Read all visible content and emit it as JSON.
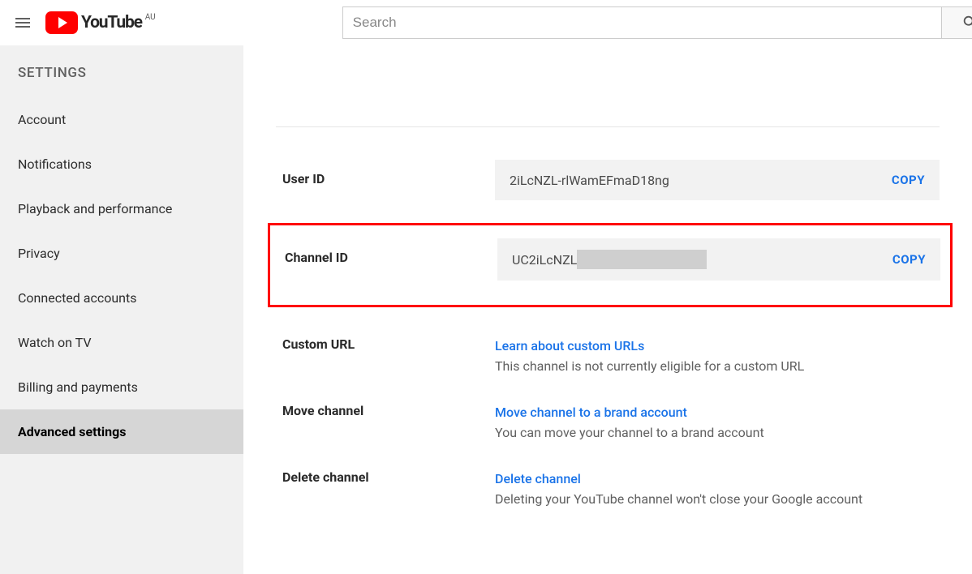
{
  "header": {
    "brand": "YouTube",
    "region": "AU",
    "search_placeholder": "Search"
  },
  "sidebar": {
    "title": "SETTINGS",
    "items": [
      {
        "label": "Account"
      },
      {
        "label": "Notifications"
      },
      {
        "label": "Playback and performance"
      },
      {
        "label": "Privacy"
      },
      {
        "label": "Connected accounts"
      },
      {
        "label": "Watch on TV"
      },
      {
        "label": "Billing and payments"
      },
      {
        "label": "Advanced settings"
      }
    ]
  },
  "main": {
    "user_id": {
      "label": "User ID",
      "value": "2iLcNZL-rlWamEFmaD18ng",
      "copy": "COPY"
    },
    "channel_id": {
      "label": "Channel ID",
      "value_prefix": "UC2iLcNZL",
      "copy": "COPY"
    },
    "custom_url": {
      "label": "Custom URL",
      "link": "Learn about custom URLs",
      "desc": "This channel is not currently eligible for a custom URL"
    },
    "move_channel": {
      "label": "Move channel",
      "link": "Move channel to a brand account",
      "desc": "You can move your channel to a brand account"
    },
    "delete_channel": {
      "label": "Delete channel",
      "link": "Delete channel",
      "desc": "Deleting your YouTube channel won't close your Google account"
    }
  }
}
